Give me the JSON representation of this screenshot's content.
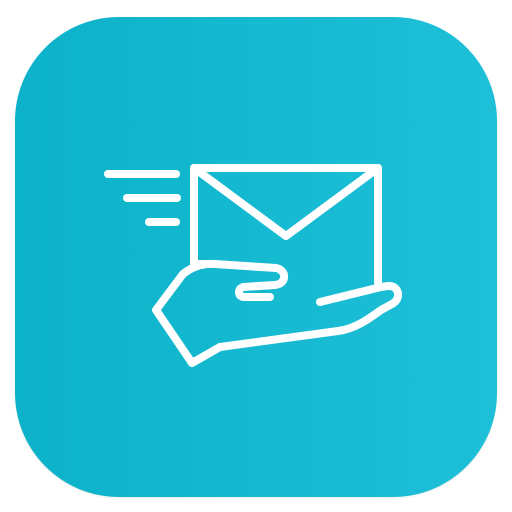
{
  "app_icon": {
    "icon": "mail-delivery-hand-icon",
    "background_gradient": [
      "#0cb2c9",
      "#1ec0d8"
    ],
    "glyph_color": "#ffffff"
  }
}
